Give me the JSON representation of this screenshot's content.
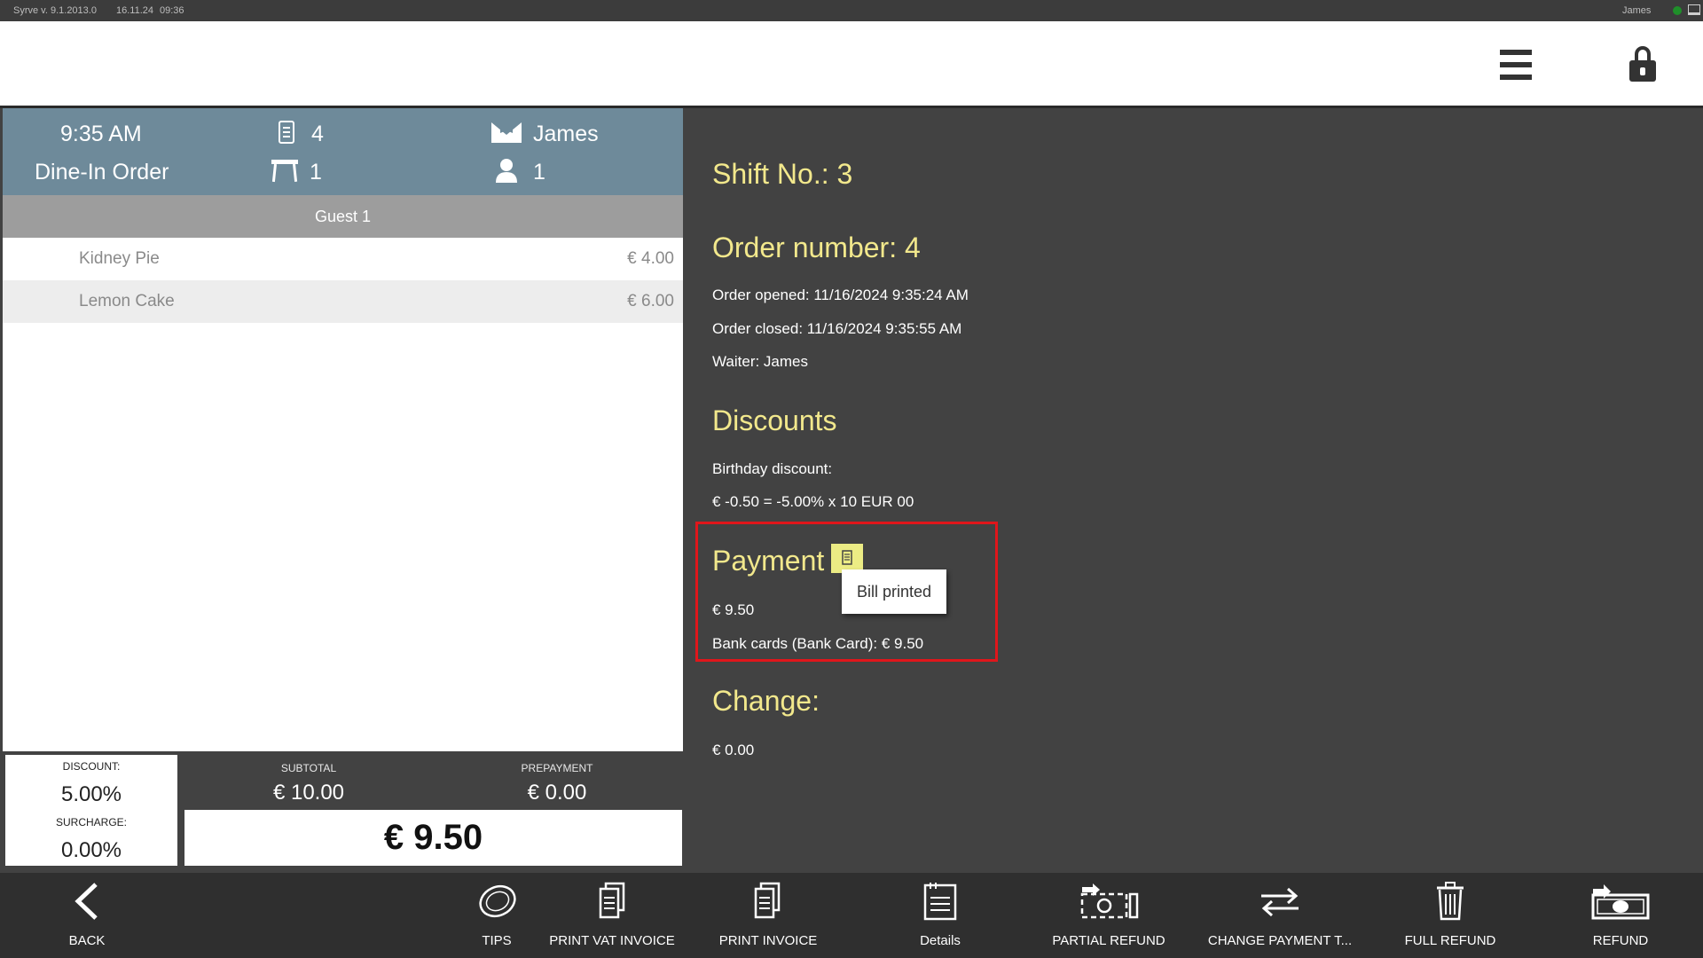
{
  "titlebar": {
    "app": "Syrve  v. 9.1.2013.0",
    "date": "16.11.24",
    "time": "09:36",
    "user": "James"
  },
  "order_header": {
    "time": "9:35 AM",
    "order_type": "Dine-In Order",
    "order_no": "4",
    "table_no": "1",
    "waiter": "James",
    "guests": "1"
  },
  "guest_label": "Guest 1",
  "items": [
    {
      "name": "Kidney Pie",
      "price": "€ 4.00"
    },
    {
      "name": "Lemon Cake",
      "price": "€ 6.00"
    }
  ],
  "totals": {
    "discount_label": "DISCOUNT:",
    "discount_value": "5.00%",
    "surcharge_label": "SURCHARGE:",
    "surcharge_value": "0.00%",
    "subtotal_label": "SUBTOTAL",
    "subtotal_value": "€ 10.00",
    "prepayment_label": "PREPAYMENT",
    "prepayment_value": "€ 0.00",
    "total": "€ 9.50"
  },
  "details": {
    "shift": "Shift No.: 3",
    "order_number": "Order number: 4",
    "opened": "Order opened: 11/16/2024 9:35:24 AM",
    "closed": "Order closed: 11/16/2024 9:35:55 AM",
    "waiter": "Waiter: James",
    "discounts_title": "Discounts",
    "discount_name": "Birthday discount:",
    "discount_calc": "€ -0.50 = -5.00% x 10 EUR 00",
    "payment_title": "Payment",
    "tooltip": "Bill printed",
    "payment_amount": "€ 9.50",
    "payment_method": "Bank cards (Bank Card): € 9.50",
    "change_title": "Change:",
    "change_amount": "€ 0.00"
  },
  "toolbar": {
    "back": "BACK",
    "tips": "TIPS",
    "print_vat_invoice": "PRINT VAT INVOICE",
    "print_invoice": "PRINT INVOICE",
    "details": "Details",
    "partial_refund": "PARTIAL REFUND",
    "change_payment": "CHANGE PAYMENT T...",
    "full_refund": "FULL REFUND",
    "refund": "REFUND"
  },
  "colors": {
    "accent_yellow": "#f2e88c",
    "header_blue": "#6e8a9a",
    "highlight_red": "#e0161b",
    "panel_dark": "#424242"
  },
  "icons": [
    "receipt-icon",
    "waiter-icon",
    "table-icon",
    "person-icon",
    "menu-icon",
    "lock-icon",
    "bill-icon",
    "back-icon",
    "coin-icon",
    "refund-icon",
    "trash-icon",
    "change-icon"
  ]
}
